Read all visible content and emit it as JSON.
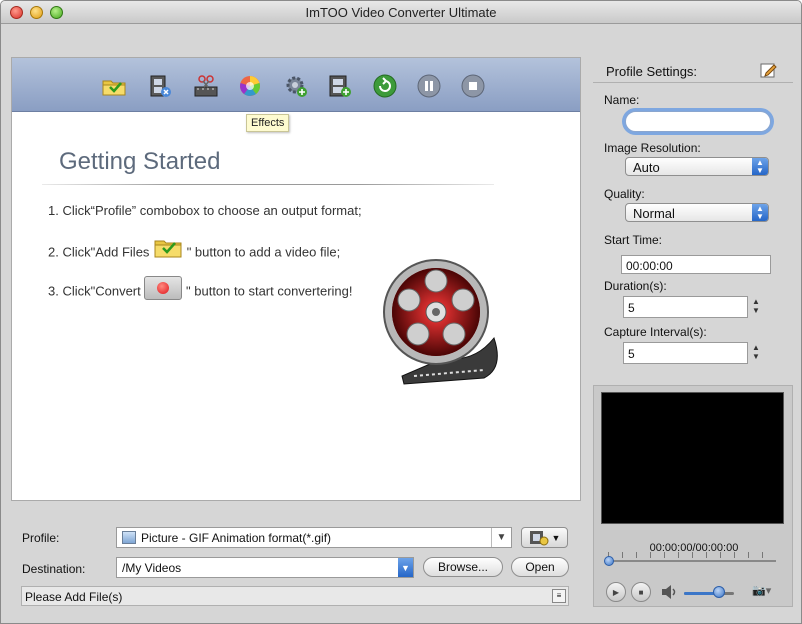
{
  "window": {
    "title": "ImTOO Video Converter Ultimate"
  },
  "toolbar": {
    "buttons": [
      {
        "name": "add-files",
        "icon": "folder-add-icon"
      },
      {
        "name": "remove",
        "icon": "film-remove-icon"
      },
      {
        "name": "clip",
        "icon": "scissors-film-icon"
      },
      {
        "name": "effects",
        "icon": "color-wheel-icon"
      },
      {
        "name": "add-profile",
        "icon": "gear-add-icon"
      },
      {
        "name": "add-output",
        "icon": "film-add-icon"
      },
      {
        "name": "convert",
        "icon": "convert-icon"
      },
      {
        "name": "pause",
        "icon": "pause-icon"
      },
      {
        "name": "stop",
        "icon": "stop-icon"
      }
    ],
    "tooltip": "Effects"
  },
  "getting_started": {
    "title": "Getting Started",
    "step1": "1. Click“Profile” combobox to choose an output format;",
    "step2_before": "2. Click\"Add Files",
    "step2_after": "\" button to add a video file;",
    "step3_before": "3. Click\"Convert",
    "step3_after": "\" button to start convertering!"
  },
  "bottom": {
    "profile_label": "Profile:",
    "profile_value": "Picture - GIF Animation format(*.gif)",
    "destination_label": "Destination:",
    "destination_value": "/My Videos",
    "browse_label": "Browse...",
    "open_label": "Open",
    "status_text": "Please Add File(s)"
  },
  "profile_settings": {
    "title": "Profile Settings:",
    "name_label": "Name:",
    "name_value": "",
    "resolution_label": "Image Resolution:",
    "resolution_value": "Auto",
    "quality_label": "Quality:",
    "quality_value": "Normal",
    "start_time_label": "Start Time:",
    "start_time_value": "00:00:00",
    "duration_label": "Duration(s):",
    "duration_value": "5",
    "capture_label": "Capture Interval(s):",
    "capture_value": "5"
  },
  "preview": {
    "time_text": "00:00:00/00:00:00",
    "volume_level": 0.7,
    "accent_color": "#3b76c8"
  }
}
